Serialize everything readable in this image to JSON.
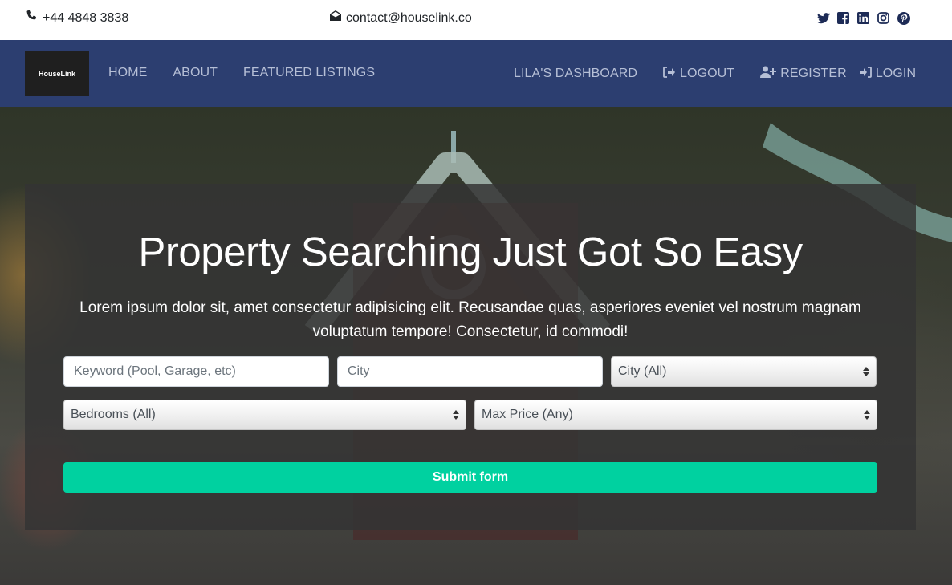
{
  "topbar": {
    "phone": "+44 4848 3838",
    "email": "contact@houselink.co",
    "social_icons": [
      "twitter-icon",
      "facebook-icon",
      "linkedin-icon",
      "instagram-icon",
      "pinterest-icon"
    ]
  },
  "navbar": {
    "logo_text": "HouseLink",
    "left_links": [
      "HOME",
      "ABOUT",
      "FEATURED LISTINGS"
    ],
    "dashboard": "LILA'S DASHBOARD",
    "logout": "LOGOUT",
    "register": "REGISTER",
    "login": "LOGIN"
  },
  "hero": {
    "title": "Property Searching Just Got So Easy",
    "subtitle": "Lorem ipsum dolor sit, amet consectetur adipisicing elit. Recusandae quas, asperiores eveniet vel nostrum magnam voluptatum tempore! Consectetur, id commodi!"
  },
  "search_form": {
    "keyword_placeholder": "Keyword (Pool, Garage, etc)",
    "city_placeholder": "City",
    "city_select": "City (All)",
    "bedrooms_select": "Bedrooms (All)",
    "max_price_select": "Max Price (Any)",
    "submit_label": "Submit form"
  },
  "colors": {
    "navbar_bg": "#2c3e70",
    "nav_link": "#b6bfd6",
    "submit_bg": "#00d1a0",
    "social_icon": "#1d2b56"
  }
}
